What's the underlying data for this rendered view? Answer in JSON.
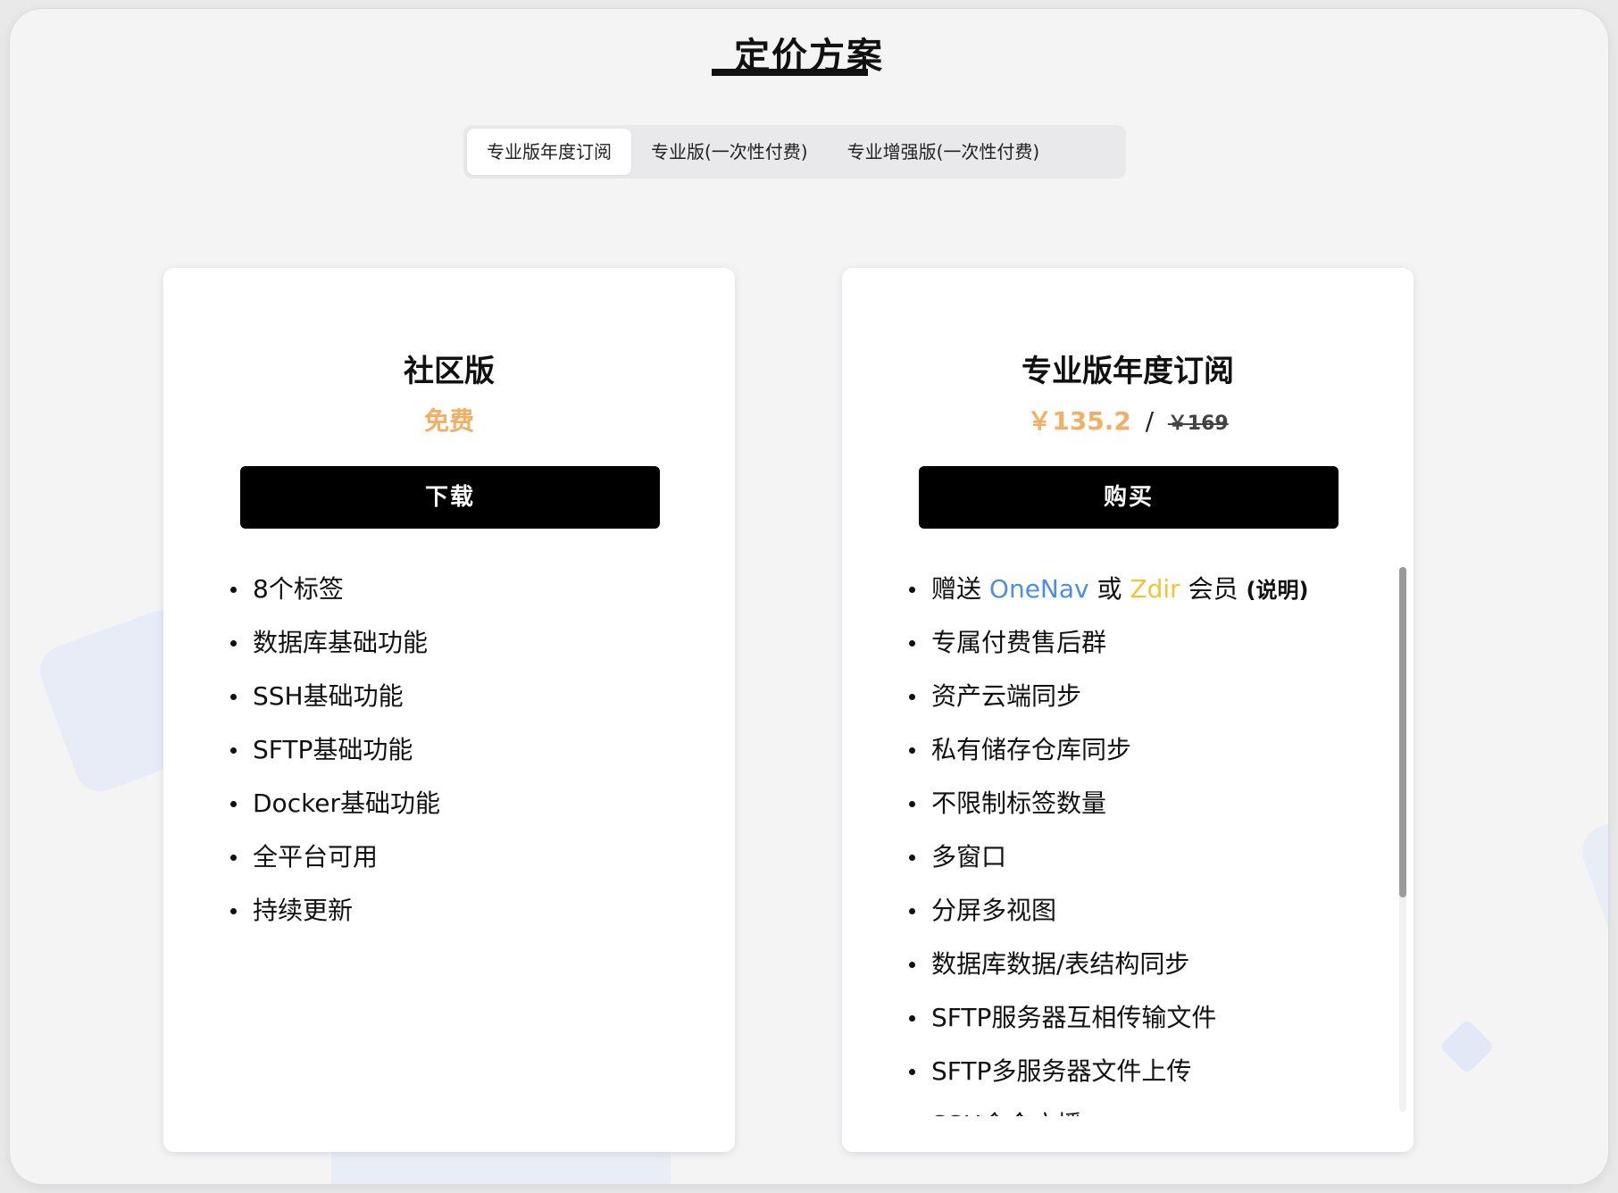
{
  "page": {
    "title": "定价方案"
  },
  "tabs": [
    {
      "label": "专业版年度订阅",
      "active": true
    },
    {
      "label": "专业版(一次性付费)",
      "active": false
    },
    {
      "label": "专业增强版(一次性付费)",
      "active": false
    }
  ],
  "colors": {
    "price": "#f4ae62",
    "onenav": "#4a8fe0",
    "zdir": "#f1c534",
    "button_bg": "#000000"
  },
  "cards": {
    "community": {
      "title": "社区版",
      "price": "免费",
      "button": "下载",
      "features": [
        "8个标签",
        "数据库基础功能",
        "SSH基础功能",
        "SFTP基础功能",
        "Docker基础功能",
        "全平台可用",
        "持续更新"
      ]
    },
    "pro": {
      "title": "专业版年度订阅",
      "price": "￥135.2",
      "price_separator": "/",
      "original_price": "￥169",
      "button": "购买",
      "first_feature": {
        "prefix": "赠送",
        "brand1": "OneNav",
        "middle": "或",
        "brand2": "Zdir",
        "suffix": "会员",
        "note": "(说明)"
      },
      "features": [
        "专属付费售后群",
        "资产云端同步",
        "私有储存仓库同步",
        "不限制标签数量",
        "多窗口",
        "分屏多视图",
        "数据库数据/表结构同步",
        "SFTP服务器互相传输文件",
        "SFTP多服务器文件上传",
        "SSH命令广播"
      ],
      "scroll_position": 0
    }
  }
}
